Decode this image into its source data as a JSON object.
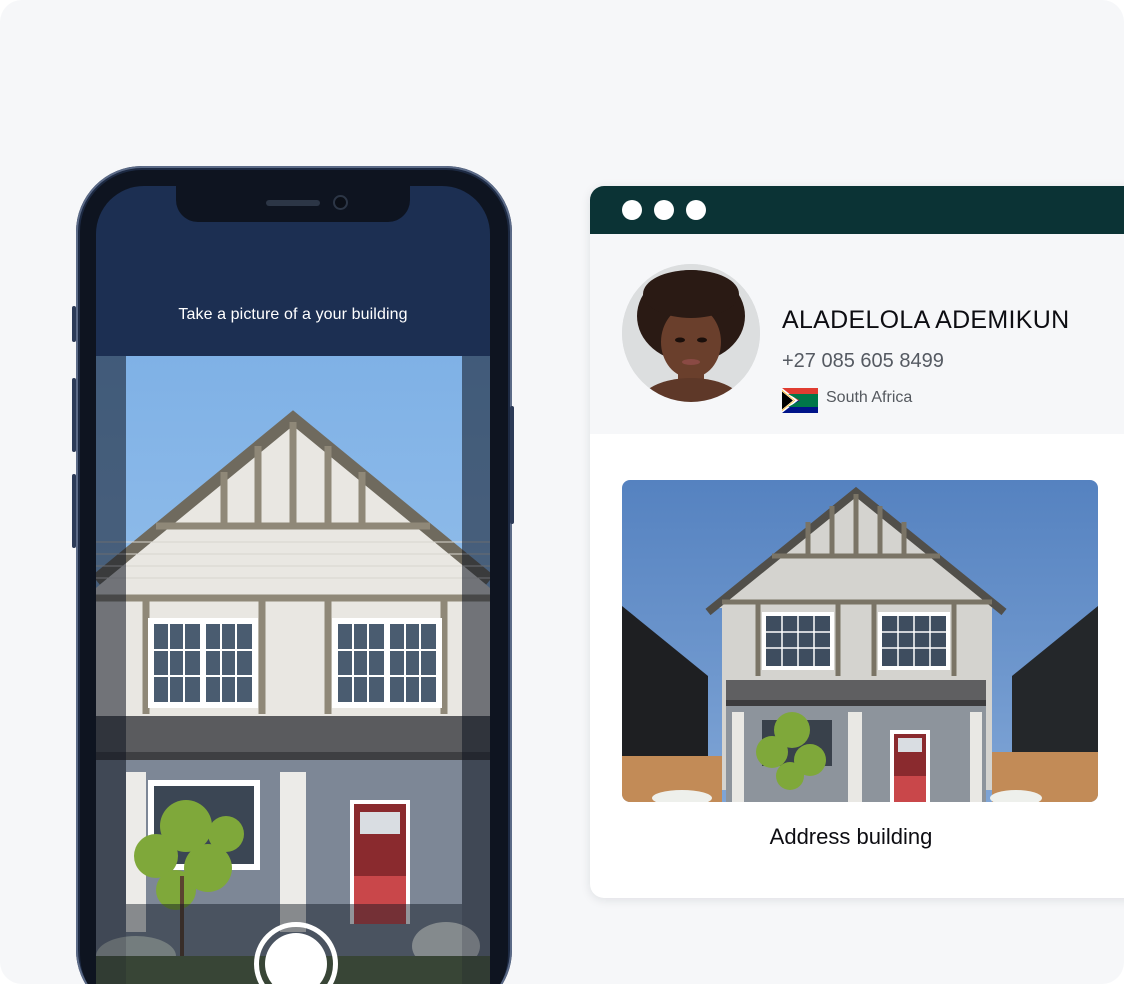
{
  "phone": {
    "instruction": "Take a picture of a your building",
    "shutter_icon": "camera-shutter-icon"
  },
  "window": {
    "controls": [
      "dot",
      "dot",
      "dot"
    ],
    "profile": {
      "name": "ALADELOLA ADEMIKUN",
      "phone": "+27 085 605 8499",
      "country": "South Africa",
      "flag_icon": "south-africa-flag-icon"
    },
    "photo_caption": "Address building"
  },
  "colors": {
    "background": "#f6f7f9",
    "phone_screen": "#1c2f52",
    "window_bar": "#0b3335",
    "door": "#8a2a2e"
  }
}
